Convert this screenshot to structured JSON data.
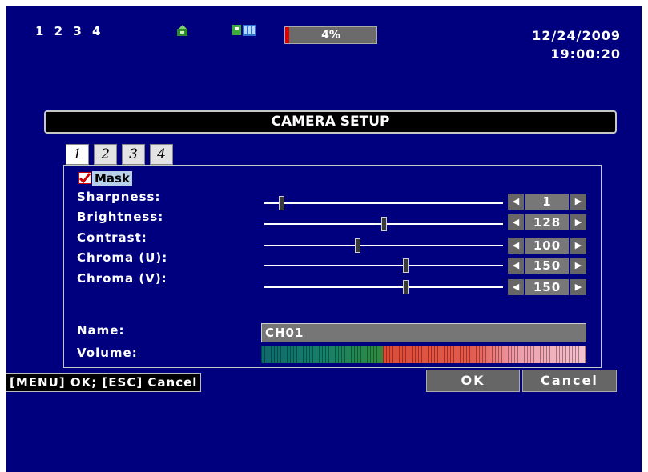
{
  "status": {
    "channels": "1 2 3 4",
    "network_icon": "network-icon",
    "record_icon": "record-icon",
    "hdd_usage_text": "4%",
    "hdd_usage_fraction": 0.04,
    "date": "12/24/2009",
    "time": "19:00:20"
  },
  "dialog": {
    "title": "CAMERA SETUP",
    "tabs": [
      "1",
      "2",
      "3",
      "4"
    ],
    "active_tab": "1",
    "mask": {
      "label": "Mask",
      "checked": true
    },
    "settings": [
      {
        "label": "Sharpness:",
        "value": "1",
        "fraction": 0.07
      },
      {
        "label": "Brightness:",
        "value": "128",
        "fraction": 0.5
      },
      {
        "label": "Contrast:",
        "value": "100",
        "fraction": 0.39
      },
      {
        "label": "Chroma (U):",
        "value": "150",
        "fraction": 0.59
      },
      {
        "label": "Chroma (V):",
        "value": "150",
        "fraction": 0.59
      }
    ],
    "name": {
      "label": "Name:",
      "value": "CH01"
    },
    "volume": {
      "label": "Volume:"
    }
  },
  "footer": {
    "help": "[MENU] OK; [ESC] Cancel",
    "ok_label": "OK",
    "cancel_label": "Cancel"
  },
  "colors": {
    "background": "#00007e",
    "title_bar": "#000000",
    "control": "#666666"
  }
}
